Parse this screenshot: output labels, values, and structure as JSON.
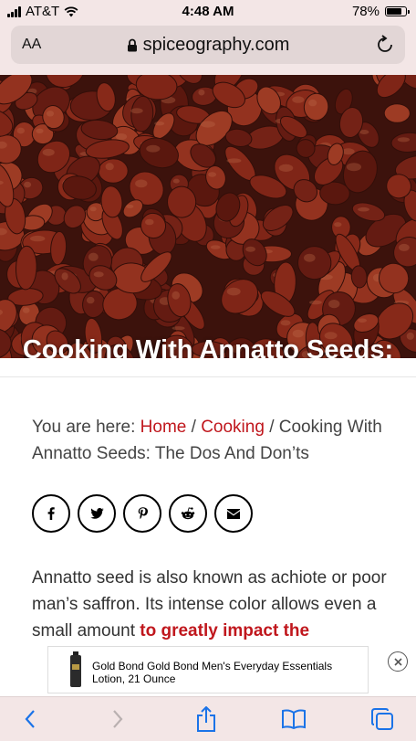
{
  "status_bar": {
    "carrier": "AT&T",
    "time": "4:48 AM",
    "battery_percent_text": "78%",
    "battery_level": 0.78
  },
  "browser": {
    "text_size_label": "AA",
    "url": "spiceography.com"
  },
  "hero": {
    "title": "Cooking With Annatto Seeds: The Dos And Don’ts"
  },
  "breadcrumb": {
    "prefix": "You are here:",
    "home": "Home",
    "sep1": "/",
    "category": "Cooking",
    "sep2": "/",
    "current": "Cooking With Annatto Seeds: The Dos And Don’ts"
  },
  "share": {
    "icons": [
      "facebook-icon",
      "twitter-icon",
      "pinterest-icon",
      "reddit-icon",
      "email-icon"
    ]
  },
  "article": {
    "text_before": "Annatto seed is also known as achiote or poor man’s saffron. Its intense color allows even a small amount ",
    "highlight": "to greatly impact the"
  },
  "ad": {
    "text": "Gold Bond Gold Bond Men's Everyday Essentials Lotion, 21 Ounce"
  },
  "colors": {
    "link_red": "#c0171d",
    "ios_blue": "#1a73e8",
    "chrome_bg": "#f3e6e6"
  }
}
